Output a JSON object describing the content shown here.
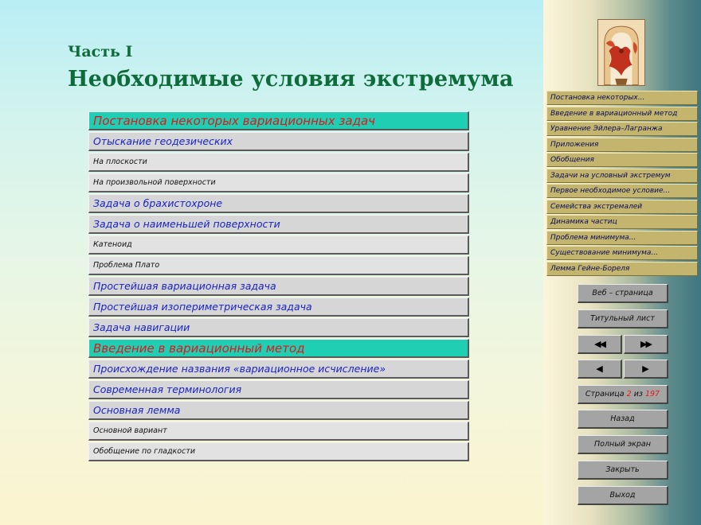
{
  "header": {
    "part": "Часть I",
    "title": "Необходимые условия экстремума"
  },
  "toc": [
    {
      "label": "Постановка некоторых вариационных задач",
      "level": 0
    },
    {
      "label": "Отыскание геодезических",
      "level": 1
    },
    {
      "label": "На плоскости",
      "level": 2
    },
    {
      "label": "На произвольной поверхности",
      "level": 2
    },
    {
      "label": "Задача о брахистохроне",
      "level": 1
    },
    {
      "label": "Задача о наименьшей поверхности",
      "level": 1
    },
    {
      "label": "Катеноид",
      "level": 2
    },
    {
      "label": "Проблема Плато",
      "level": 2
    },
    {
      "label": "Простейшая вариационная задача",
      "level": 1
    },
    {
      "label": "Простейшая изопериметрическая задача",
      "level": 1
    },
    {
      "label": "Задача навигации",
      "level": 1
    },
    {
      "label": "Введение в вариационный метод",
      "level": 0
    },
    {
      "label": "Происхождение названия «вариационное исчисление»",
      "level": 1
    },
    {
      "label": "Современная терминология",
      "level": 1
    },
    {
      "label": "Основная лемма",
      "level": 1
    },
    {
      "label": "Основной вариант",
      "level": 2
    },
    {
      "label": "Обобщение по гладкости",
      "level": 2
    }
  ],
  "sidebar": {
    "items": [
      {
        "label": "Постановка некоторых..."
      },
      {
        "label": "Введение в вариационный метод"
      },
      {
        "label": "Уравнение Эйлера–Лагранжа"
      },
      {
        "label": "Приложения"
      },
      {
        "label": "Обобщения"
      },
      {
        "label": "Задачи на условный экстремум"
      },
      {
        "label": "Первое необходимое условие..."
      },
      {
        "label": "Семейства экстремалей"
      },
      {
        "label": "Динамика частиц"
      },
      {
        "label": "Проблема минимума..."
      },
      {
        "label": "Существование минимума..."
      },
      {
        "label": "Лемма Гейне-Бореля"
      }
    ]
  },
  "controls": {
    "web_page": "Веб – страница",
    "title_page": "Титульный лист",
    "first_icon": "double-left-arrow",
    "last_icon": "double-right-arrow",
    "prev_icon": "left-arrow",
    "next_icon": "right-arrow",
    "page_prefix": "Страница",
    "page_current": "2",
    "page_sep": "из",
    "page_total": "197",
    "back": "Назад",
    "fullscreen": "Полный экран",
    "close": "Закрыть",
    "exit": "Выход"
  },
  "colors": {
    "title_green": "#0e6b3a",
    "section_bg": "#1ecfb4",
    "section_text": "#e8141a",
    "subsection_text": "#1a22c8",
    "nav_item_bg": "#c3b56e",
    "button_bg": "#a4a4a4"
  }
}
